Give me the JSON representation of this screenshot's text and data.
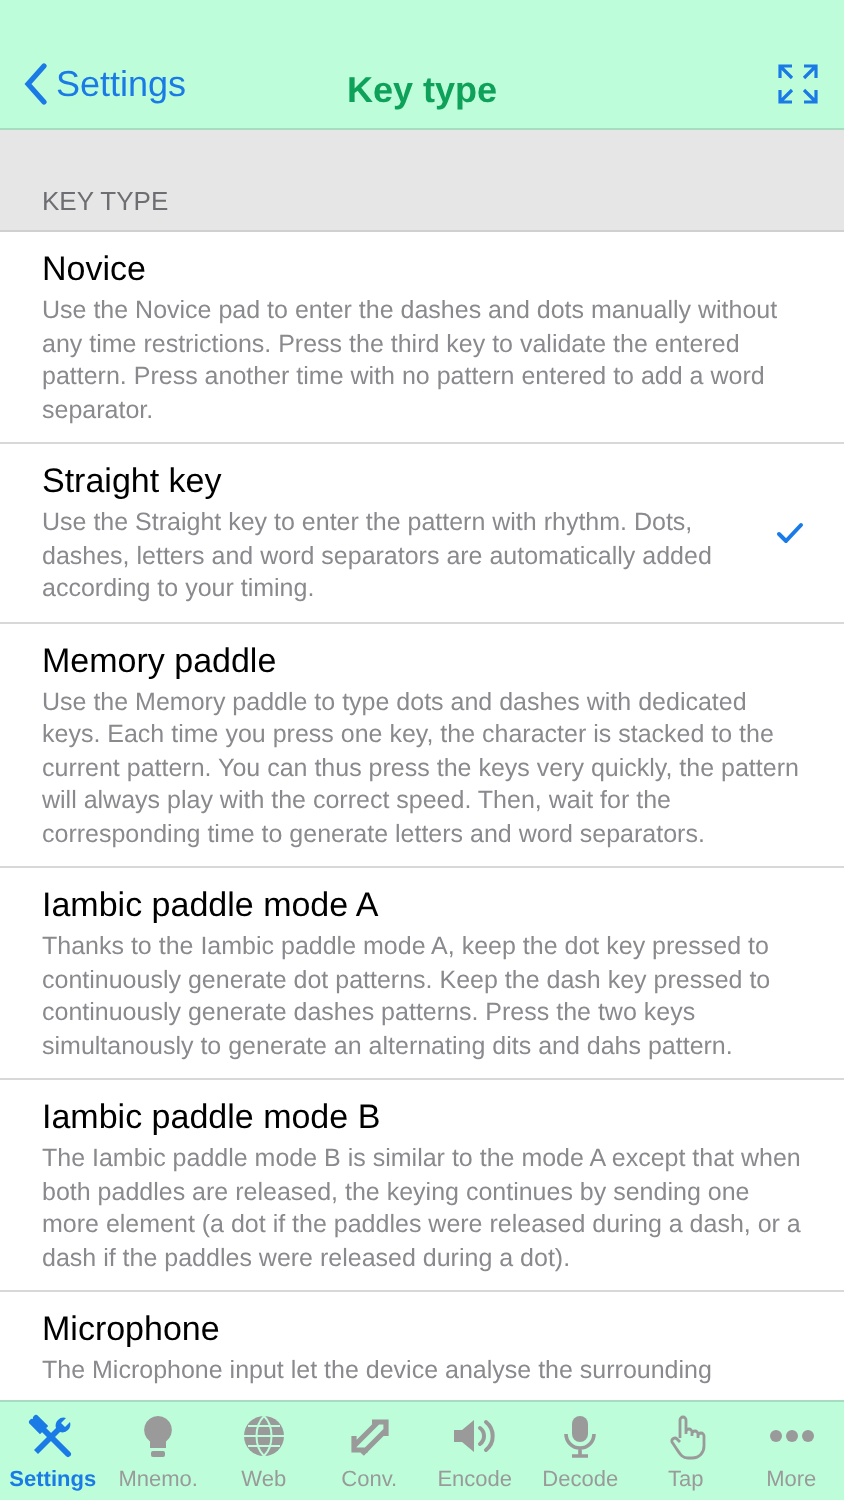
{
  "nav": {
    "back": "Settings",
    "title": "Key type"
  },
  "section": "KEY TYPE",
  "options": [
    {
      "title": "Novice",
      "description": "Use the Novice pad to enter the dashes and dots manually without any time restrictions. Press the third key to validate the entered pattern. Press another time with no pattern entered to add a word separator.",
      "selected": false
    },
    {
      "title": "Straight key",
      "description": "Use the Straight key to enter the pattern with rhythm. Dots, dashes, letters and word separators are automatically added according to your timing.",
      "selected": true
    },
    {
      "title": "Memory paddle",
      "description": "Use the Memory paddle to type dots and dashes with dedicated keys. Each time you press one key, the character is stacked to the current pattern. You can thus press the keys very quickly, the pattern will always play with the correct speed. Then, wait for the corresponding time to generate letters and word separators.",
      "selected": false
    },
    {
      "title": "Iambic paddle mode A",
      "description": "Thanks to the Iambic paddle mode A, keep the dot key pressed to continuously generate dot patterns. Keep the dash key pressed to continuously generate dashes patterns. Press the two keys simultanously to generate an alternating dits and dahs pattern.",
      "selected": false
    },
    {
      "title": "Iambic paddle mode B",
      "description": "The Iambic paddle mode B is similar to the mode A except that when both paddles are released, the keying continues by sending one more element (a dot if the paddles were released during a dash, or a dash if the paddles were released during a dot).",
      "selected": false
    },
    {
      "title": "Microphone",
      "description": "The Microphone input let the device analyse the surrounding",
      "selected": false
    }
  ],
  "tabs": [
    {
      "label": "Settings",
      "kind": "tools",
      "selected": true
    },
    {
      "label": "Mnemo.",
      "kind": "bulb",
      "selected": false
    },
    {
      "label": "Web",
      "kind": "globe",
      "selected": false
    },
    {
      "label": "Conv.",
      "kind": "arrows",
      "selected": false
    },
    {
      "label": "Encode",
      "kind": "speaker",
      "selected": false
    },
    {
      "label": "Decode",
      "kind": "mic",
      "selected": false
    },
    {
      "label": "Tap",
      "kind": "hand",
      "selected": false
    },
    {
      "label": "More",
      "kind": "dots",
      "selected": false
    }
  ]
}
